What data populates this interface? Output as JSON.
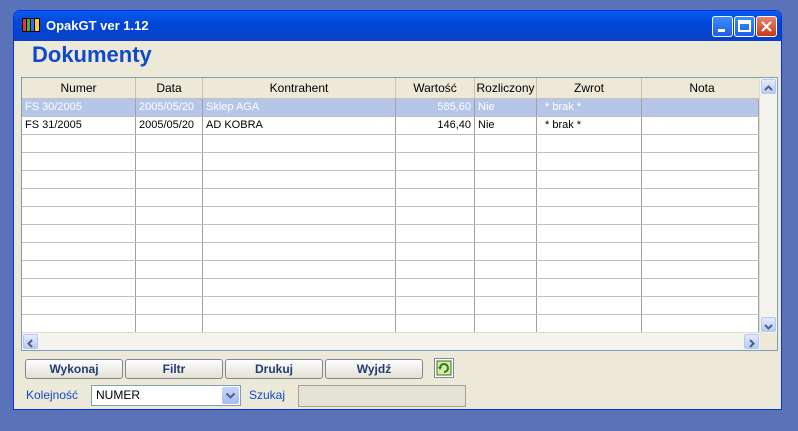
{
  "window": {
    "title": "OpakGT ver 1.12",
    "heading": "Dokumenty"
  },
  "table": {
    "columns": [
      "Numer",
      "Data",
      "Kontrahent",
      "Wartość",
      "Rozliczony",
      "Zwrot",
      "Nota"
    ],
    "rows": [
      {
        "numer": "FS 30/2005",
        "data": "2005/05/20",
        "kontrahent": "Sklep AGA",
        "wartosc": "585,60",
        "rozliczony": "Nie",
        "zwrot": "* brak *",
        "nota": "",
        "selected": true
      },
      {
        "numer": "FS 31/2005",
        "data": "2005/05/20",
        "kontrahent": "AD KOBRA",
        "wartosc": "146,40",
        "rozliczony": "Nie",
        "zwrot": "* brak *",
        "nota": "",
        "selected": false
      }
    ],
    "empty_row_count": 11
  },
  "buttons": {
    "wykonaj": "Wykonaj",
    "filtr": "Filtr",
    "drukuj": "Drukuj",
    "wyjdz": "Wyjdź"
  },
  "footer": {
    "order_label": "Kolejność",
    "order_value": "NUMER",
    "search_label": "Szukaj",
    "search_value": ""
  },
  "colors": {
    "titlebar": "#0a5bf0",
    "heading": "#1049c9",
    "selection": "#b6c6ea",
    "window_bg": "#ece9d8"
  }
}
